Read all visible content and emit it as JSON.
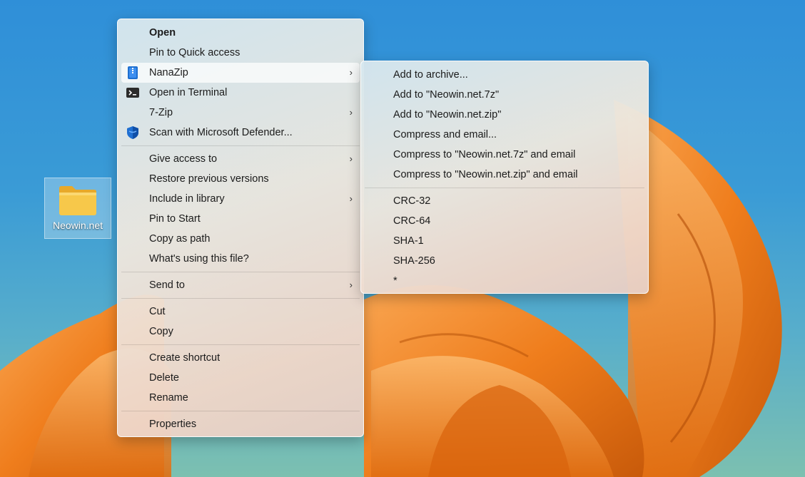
{
  "desktop": {
    "folder_label": "Neowin.net"
  },
  "context_menu": {
    "groups": [
      [
        {
          "label": "Open",
          "bold": true,
          "icon": "",
          "submenu": false
        },
        {
          "label": "Pin to Quick access",
          "icon": "",
          "submenu": false
        },
        {
          "label": "NanaZip",
          "icon": "nanazip-icon",
          "submenu": true,
          "highlighted": true
        },
        {
          "label": "Open in Terminal",
          "icon": "terminal-icon",
          "submenu": false
        },
        {
          "label": "7-Zip",
          "icon": "",
          "submenu": true
        },
        {
          "label": "Scan with Microsoft Defender...",
          "icon": "defender-shield-icon",
          "submenu": false
        }
      ],
      [
        {
          "label": "Give access to",
          "submenu": true
        },
        {
          "label": "Restore previous versions",
          "submenu": false
        },
        {
          "label": "Include in library",
          "submenu": true
        },
        {
          "label": "Pin to Start",
          "submenu": false
        },
        {
          "label": "Copy as path",
          "submenu": false
        },
        {
          "label": "What's using this file?",
          "submenu": false
        }
      ],
      [
        {
          "label": "Send to",
          "submenu": true
        }
      ],
      [
        {
          "label": "Cut",
          "submenu": false
        },
        {
          "label": "Copy",
          "submenu": false
        }
      ],
      [
        {
          "label": "Create shortcut",
          "submenu": false
        },
        {
          "label": "Delete",
          "submenu": false
        },
        {
          "label": "Rename",
          "submenu": false
        }
      ],
      [
        {
          "label": "Properties",
          "submenu": false
        }
      ]
    ],
    "submenu_chevron": "›"
  },
  "nanazip_submenu": {
    "groups": [
      [
        "Add to archive...",
        "Add to \"Neowin.net.7z\"",
        "Add to \"Neowin.net.zip\"",
        "Compress and email...",
        "Compress to \"Neowin.net.7z\" and email",
        "Compress to \"Neowin.net.zip\" and email"
      ],
      [
        "CRC-32",
        "CRC-64",
        "SHA-1",
        "SHA-256",
        "*"
      ]
    ]
  },
  "colors": {
    "wallpaper_sky": "#2f8fd8",
    "wallpaper_bloom": "#f0801f",
    "folder_yellow": "#f7c84a",
    "defender_blue": "#1f6fd1"
  }
}
